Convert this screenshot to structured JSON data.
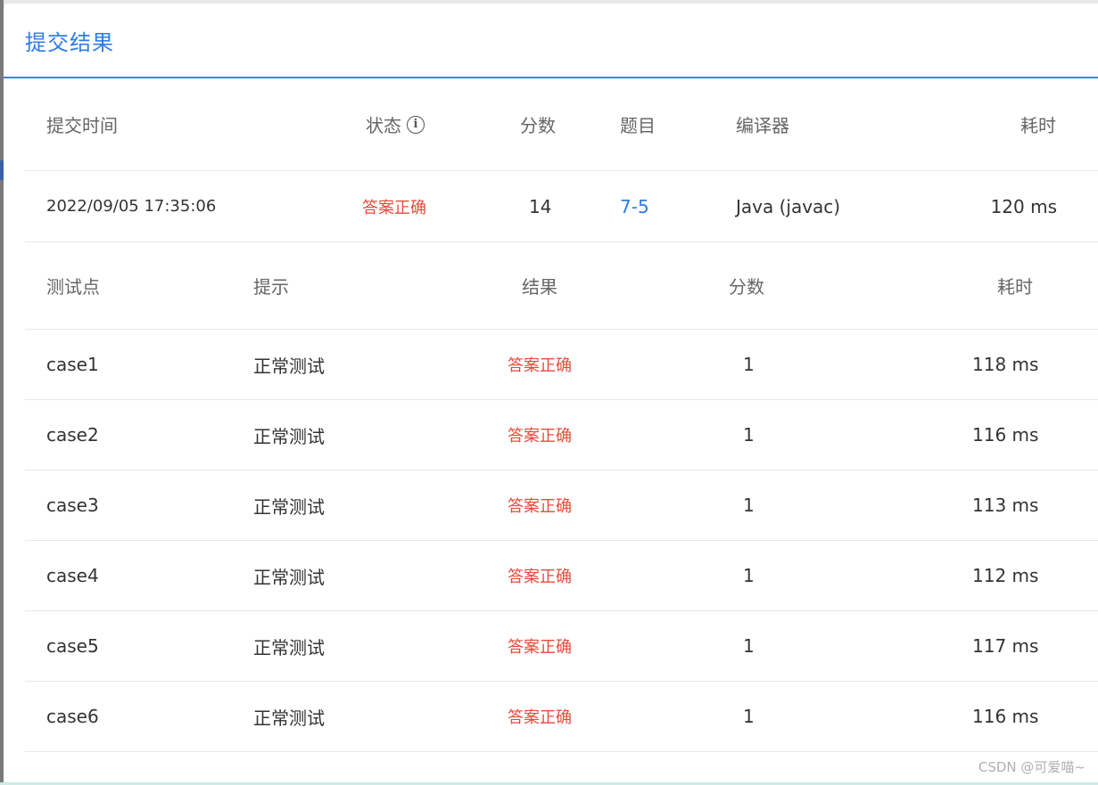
{
  "dialog": {
    "title": "提交结果"
  },
  "summary": {
    "headers": {
      "time": "提交时间",
      "status": "状态",
      "score": "分数",
      "problem": "题目",
      "compiler": "编译器",
      "elapsed": "耗时"
    },
    "row": {
      "time": "2022/09/05 17:35:06",
      "status": "答案正确",
      "score": "14",
      "problem": "7-5",
      "compiler": "Java (javac)",
      "elapsed": "120 ms"
    }
  },
  "cases": {
    "headers": {
      "point": "测试点",
      "hint": "提示",
      "result": "结果",
      "score": "分数",
      "elapsed": "耗时"
    },
    "rows": [
      {
        "point": "case1",
        "hint": "正常测试",
        "result": "答案正确",
        "score": "1",
        "elapsed": "118 ms"
      },
      {
        "point": "case2",
        "hint": "正常测试",
        "result": "答案正确",
        "score": "1",
        "elapsed": "116 ms"
      },
      {
        "point": "case3",
        "hint": "正常测试",
        "result": "答案正确",
        "score": "1",
        "elapsed": "113 ms"
      },
      {
        "point": "case4",
        "hint": "正常测试",
        "result": "答案正确",
        "score": "1",
        "elapsed": "112 ms"
      },
      {
        "point": "case5",
        "hint": "正常测试",
        "result": "答案正确",
        "score": "1",
        "elapsed": "117 ms"
      },
      {
        "point": "case6",
        "hint": "正常测试",
        "result": "答案正确",
        "score": "1",
        "elapsed": "116 ms"
      }
    ]
  },
  "watermark": "CSDN @可爱喵~",
  "colors": {
    "accent": "#2f7ce6",
    "success_text": "#e84a3a"
  },
  "icons": {
    "status_info": "info-icon"
  }
}
